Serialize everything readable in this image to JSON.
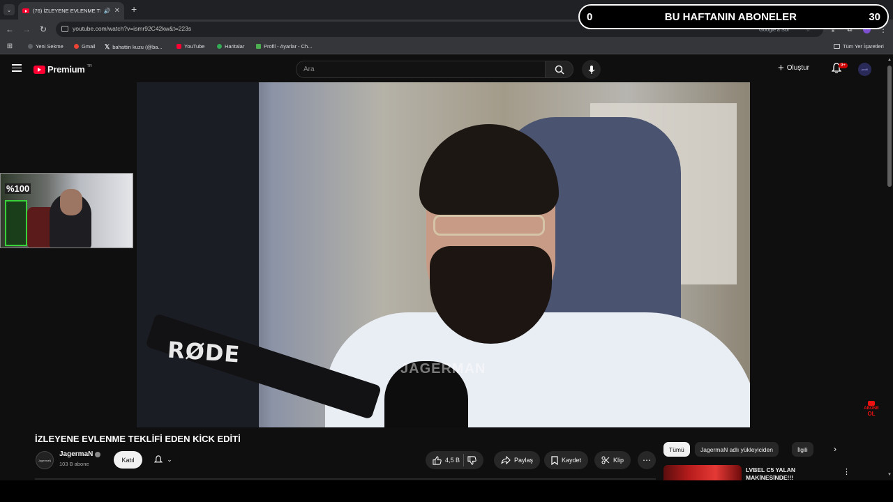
{
  "browser": {
    "tab_title": "(76) İZLEYENE EVLENME TE...",
    "url": "youtube.com/watch?v=ismr92C42kw&t=223s",
    "google_translate": "Google'a Sor",
    "bookmarks": [
      {
        "label": "Yeni Sekme",
        "color": "#5f6368"
      },
      {
        "label": "Gmail",
        "color": "#ea4335"
      },
      {
        "label": "bahattin kuzu (@ba...",
        "color": "#000000"
      },
      {
        "label": "YouTube",
        "color": "#ff0033"
      },
      {
        "label": "Haritalar",
        "color": "#34a853"
      },
      {
        "label": "Profil - Ayarlar - Ch...",
        "color": "#4caf50"
      }
    ],
    "all_bookmarks": "Tüm Yer İşaretleri"
  },
  "overlay": {
    "left_count": "0",
    "title": "BU HAFTANIN ABONELER",
    "right_count": "30"
  },
  "masthead": {
    "logo_word": "Premium",
    "logo_country": "TR",
    "search_placeholder": "Ara",
    "create_label": "Oluştur",
    "notif_badge": "9+",
    "avatar_text": "profil"
  },
  "video": {
    "rode_text": "RØDE",
    "watermark": "JAGERMAN"
  },
  "webcam": {
    "logo_text": "%100"
  },
  "abone_badge": {
    "line1": "ABONE",
    "line2": "OL"
  },
  "info": {
    "title": "İZLEYENE EVLENME TEKLİFİ EDEN KİCK EDİTİ",
    "channel_name": "JagermaN",
    "channel_avatar_text": "JagermaN",
    "subscribers": "103 B abone",
    "join_label": "Katıl",
    "likes": "4,5 B",
    "share_label": "Paylaş",
    "save_label": "Kaydet",
    "clip_label": "Klip"
  },
  "chips": [
    "Tümü",
    "JagermaN adlı yükleyiciden",
    "İlgili"
  ],
  "recommended": {
    "title": "LVBEL C5 YALAN MAKİNESİNDE!!!"
  }
}
